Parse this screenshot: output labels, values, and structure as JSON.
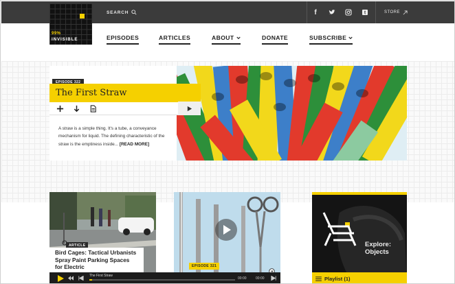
{
  "header": {
    "search_label": "SEARCH",
    "store_label": "STORE",
    "social": [
      "facebook-icon",
      "twitter-icon",
      "instagram-icon",
      "tumblr-icon"
    ]
  },
  "logo": {
    "line1": "99%",
    "line2": "INVISIBLE"
  },
  "nav": {
    "items": [
      {
        "label": "EPISODES"
      },
      {
        "label": "ARTICLES"
      },
      {
        "label": "ABOUT"
      },
      {
        "label": "DONATE"
      },
      {
        "label": "SUBSCRIBE"
      }
    ]
  },
  "feature": {
    "episode_tag": "EPISODE 322",
    "title": "The First Straw",
    "description": "A straw is a simple thing. It's a tube, a conveyance mechanism for liquid. The defining characteristic of the straw is the emptiness inside...",
    "read_more": "[READ MORE]"
  },
  "cards": [
    {
      "tag": "ARTICLE",
      "title": "Bird Cages: Tactical Urbanists Spray Paint Parking Spaces for Electric"
    },
    {
      "tag": "EPISODE 321"
    },
    {
      "title_line1": "Explore:",
      "title_line2": "Objects",
      "playlist_label": "Playlist (1)"
    }
  ],
  "player": {
    "track_title": "The First Straw",
    "time_elapsed": "00:00",
    "time_total": "00:00",
    "progress": 0.02
  },
  "colors": {
    "accent": "#f5d000",
    "dark": "#3b3b3b"
  }
}
